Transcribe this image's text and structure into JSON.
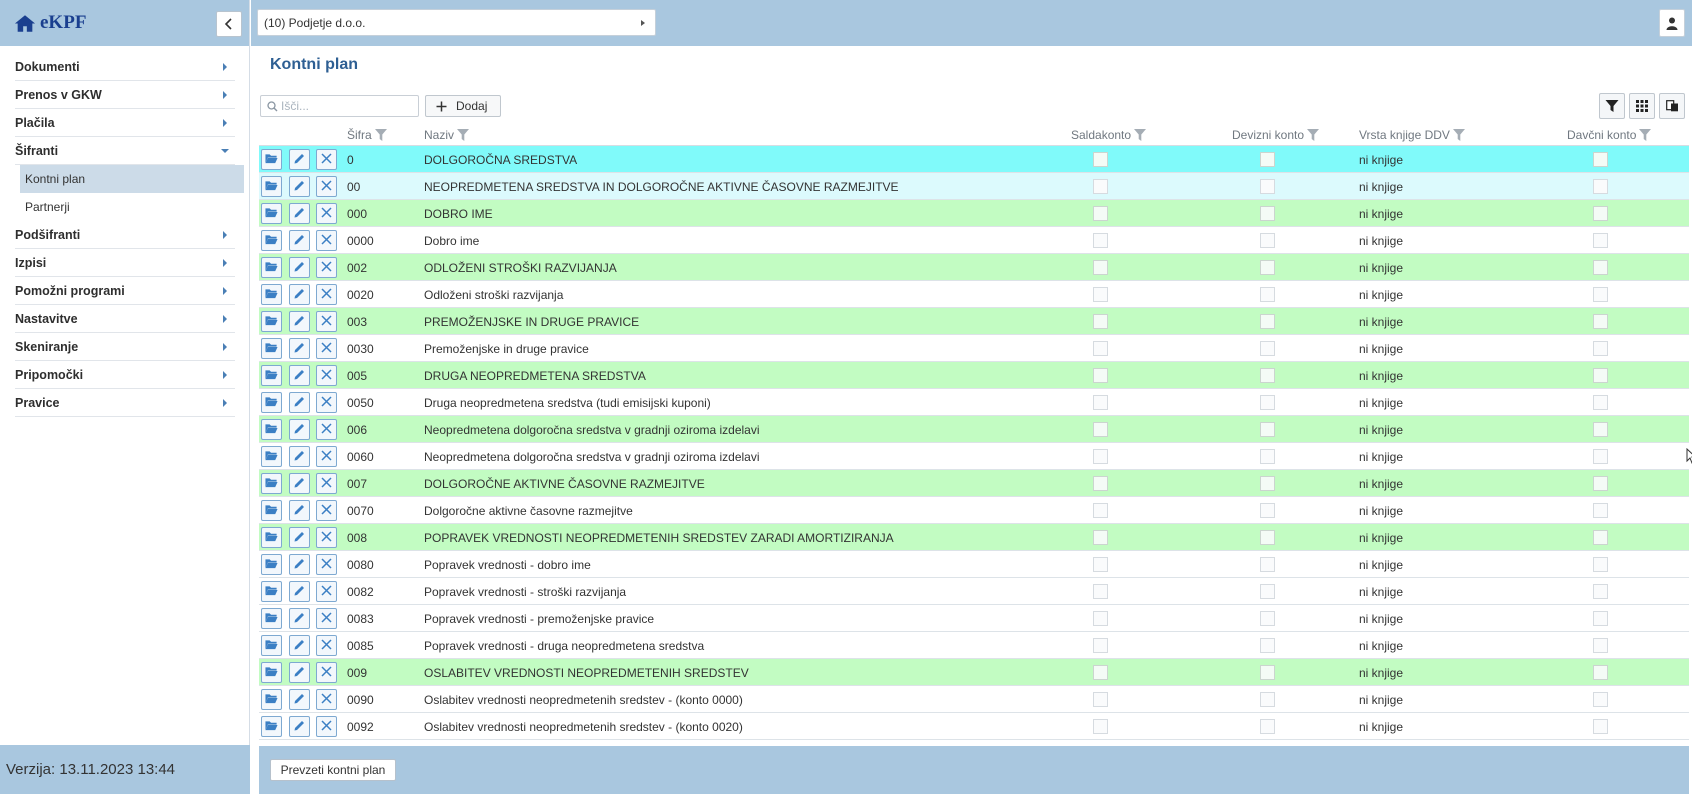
{
  "app": {
    "brand": "eKPF",
    "version": "Verzija: 13.11.2023 13:44"
  },
  "topbar": {
    "company": "(10) Podjetje d.o.o."
  },
  "sidebar": {
    "items": [
      {
        "label": "Dokumenti"
      },
      {
        "label": "Prenos v GKW"
      },
      {
        "label": "Plačila"
      },
      {
        "label": "Šifranti",
        "open": true,
        "children": [
          {
            "label": "Kontni plan",
            "active": true
          },
          {
            "label": "Partnerji"
          }
        ]
      },
      {
        "label": "Podšifranti"
      },
      {
        "label": "Izpisi"
      },
      {
        "label": "Pomožni programi"
      },
      {
        "label": "Nastavitve"
      },
      {
        "label": "Skeniranje"
      },
      {
        "label": "Pripomočki"
      },
      {
        "label": "Pravice"
      }
    ]
  },
  "main": {
    "title": "Kontni plan",
    "search_placeholder": "Išči...",
    "add_label": "Dodaj",
    "import_label": "Prevzeti kontni plan"
  },
  "grid": {
    "columns": {
      "code": "Šifra",
      "name": "Naziv",
      "saldakonto": "Saldakonto",
      "devizni": "Devizni konto",
      "vrsta": "Vrsta knjige DDV",
      "davcni": "Davčni konto"
    },
    "rows": [
      {
        "code": "0",
        "name": "DOLGOROČNA SREDSTVA",
        "vrsta": "ni knjige",
        "style": "sel"
      },
      {
        "code": "00",
        "name": "NEOPREDMETENA SREDSTVA IN DOLGOROČNE AKTIVNE ČASOVNE RAZMEJITVE",
        "vrsta": "ni knjige",
        "style": "hover"
      },
      {
        "code": "000",
        "name": "DOBRO IME",
        "vrsta": "ni knjige",
        "style": "grp"
      },
      {
        "code": "0000",
        "name": "Dobro ime",
        "vrsta": "ni knjige",
        "style": ""
      },
      {
        "code": "002",
        "name": "ODLOŽENI STROŠKI RAZVIJANJA",
        "vrsta": "ni knjige",
        "style": "grp"
      },
      {
        "code": "0020",
        "name": "Odloženi stroški razvijanja",
        "vrsta": "ni knjige",
        "style": ""
      },
      {
        "code": "003",
        "name": "PREMOŽENJSKE IN DRUGE PRAVICE",
        "vrsta": "ni knjige",
        "style": "grp"
      },
      {
        "code": "0030",
        "name": "Premoženjske in druge pravice",
        "vrsta": "ni knjige",
        "style": ""
      },
      {
        "code": "005",
        "name": "DRUGA NEOPREDMETENA SREDSTVA",
        "vrsta": "ni knjige",
        "style": "grp"
      },
      {
        "code": "0050",
        "name": "Druga neopredmetena sredstva (tudi emisijski kuponi)",
        "vrsta": "ni knjige",
        "style": ""
      },
      {
        "code": "006",
        "name": "Neopredmetena dolgoročna sredstva v gradnji oziroma izdelavi",
        "vrsta": "ni knjige",
        "style": "grp"
      },
      {
        "code": "0060",
        "name": "Neopredmetena dolgoročna sredstva v gradnji oziroma izdelavi",
        "vrsta": "ni knjige",
        "style": ""
      },
      {
        "code": "007",
        "name": "DOLGOROČNE AKTIVNE ČASOVNE RAZMEJITVE",
        "vrsta": "ni knjige",
        "style": "grp"
      },
      {
        "code": "0070",
        "name": "Dolgoročne aktivne časovne razmejitve",
        "vrsta": "ni knjige",
        "style": ""
      },
      {
        "code": "008",
        "name": "POPRAVEK VREDNOSTI NEOPREDMETENIH SREDSTEV ZARADI AMORTIZIRANJA",
        "vrsta": "ni knjige",
        "style": "grp"
      },
      {
        "code": "0080",
        "name": "Popravek vrednosti - dobro ime",
        "vrsta": "ni knjige",
        "style": ""
      },
      {
        "code": "0082",
        "name": "Popravek vrednosti - stroški razvijanja",
        "vrsta": "ni knjige",
        "style": ""
      },
      {
        "code": "0083",
        "name": "Popravek vrednosti - premoženjske pravice",
        "vrsta": "ni knjige",
        "style": ""
      },
      {
        "code": "0085",
        "name": "Popravek vrednosti - druga neopredmetena sredstva",
        "vrsta": "ni knjige",
        "style": ""
      },
      {
        "code": "009",
        "name": "OSLABITEV VREDNOSTI NEOPREDMETENIH SREDSTEV",
        "vrsta": "ni knjige",
        "style": "grp"
      },
      {
        "code": "0090",
        "name": "Oslabitev vrednosti neopredmetenih sredstev - (konto 0000)",
        "vrsta": "ni knjige",
        "style": ""
      },
      {
        "code": "0092",
        "name": "Oslabitev vrednosti neopredmetenih sredstev - (konto 0020)",
        "vrsta": "ni knjige",
        "style": ""
      }
    ]
  },
  "colors": {
    "header_bar": "#a9c7df",
    "group_row": "#c2fcc2",
    "selected_row": "#80fafa",
    "title": "#2e5f93"
  }
}
